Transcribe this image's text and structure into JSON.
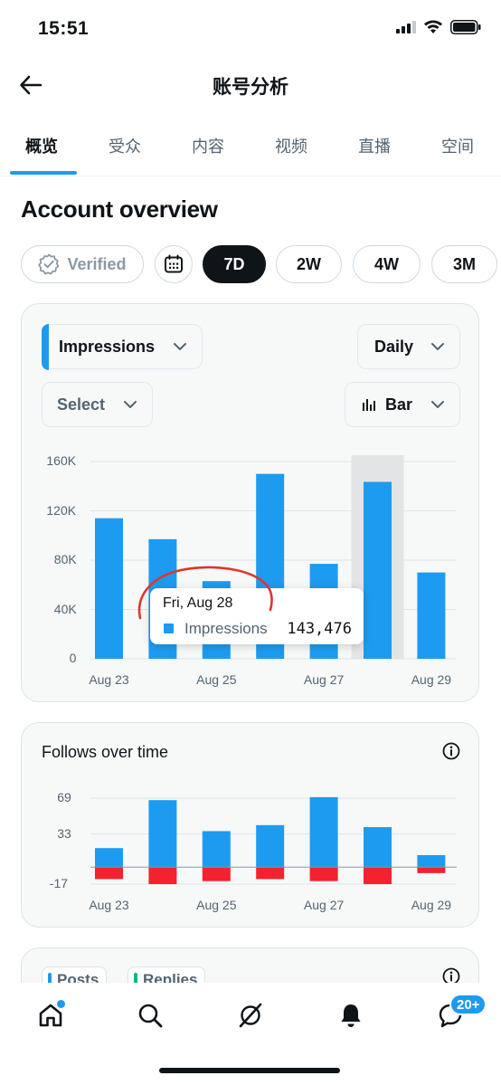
{
  "status": {
    "time": "15:51"
  },
  "nav": {
    "title": "账号分析"
  },
  "tabs": [
    {
      "label": "概览",
      "active": true
    },
    {
      "label": "受众"
    },
    {
      "label": "内容"
    },
    {
      "label": "视频"
    },
    {
      "label": "直播"
    },
    {
      "label": "空间"
    }
  ],
  "overview": {
    "title": "Account overview",
    "verified_label": "Verified",
    "ranges": [
      "7D",
      "2W",
      "4W",
      "3M"
    ],
    "active_range": "7D"
  },
  "impressions_card": {
    "metric_select": "Impressions",
    "interval_select": "Daily",
    "compare_select": "Select",
    "chart_type_select": "Bar",
    "tooltip": {
      "date": "Fri, Aug 28",
      "series": "Impressions",
      "value": "143,476"
    }
  },
  "follows_card": {
    "title": "Follows over time"
  },
  "posts_card": {
    "legend": [
      "Posts",
      "Replies"
    ]
  },
  "bottom_nav": {
    "messages_badge": "20+"
  },
  "colors": {
    "accent": "#1d9bf0",
    "negative": "#f4212e",
    "text": "#0f1419",
    "muted": "#536471"
  },
  "chart_data": [
    {
      "type": "bar",
      "title": "",
      "categories": [
        "Aug 23",
        "Aug 24",
        "Aug 25",
        "Aug 26",
        "Aug 27",
        "Aug 28",
        "Aug 29"
      ],
      "x_tick_labels": [
        "Aug 23",
        "Aug 25",
        "Aug 27",
        "Aug 29"
      ],
      "series": [
        {
          "name": "Impressions",
          "values": [
            114000,
            97000,
            63000,
            150000,
            77000,
            143476,
            70000
          ]
        }
      ],
      "y_ticks": [
        "160K",
        "120K",
        "80K",
        "40K",
        "0"
      ],
      "ylim": [
        0,
        160000
      ],
      "highlighted_category": "Aug 28",
      "grid": true
    },
    {
      "type": "bar",
      "title": "Follows over time",
      "categories": [
        "Aug 23",
        "Aug 24",
        "Aug 25",
        "Aug 26",
        "Aug 27",
        "Aug 28",
        "Aug 29"
      ],
      "x_tick_labels": [
        "Aug 23",
        "Aug 25",
        "Aug 27",
        "Aug 29"
      ],
      "series": [
        {
          "values": [
            19,
            67,
            36,
            42,
            70,
            40,
            12
          ]
        },
        {
          "values": [
            -12,
            -17,
            -14,
            -12,
            -14,
            -17,
            -6
          ]
        }
      ],
      "y_ticks": [
        "69",
        "33",
        "-17"
      ],
      "ylim": [
        -17,
        69
      ],
      "grid": true
    }
  ]
}
